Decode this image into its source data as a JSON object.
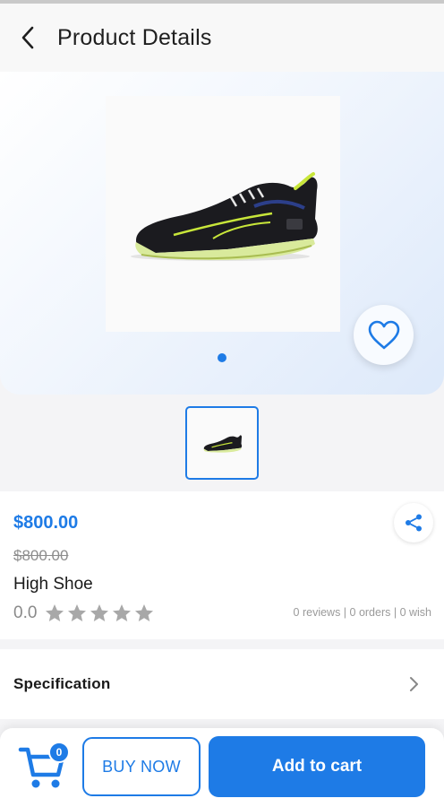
{
  "header": {
    "title": "Product Details",
    "back_icon": "chevron-left-icon"
  },
  "gallery": {
    "image": "running-shoe-image",
    "wishlist_icon": "heart-outline-icon",
    "page_indicator_count": 1,
    "active_page": 1,
    "thumbnails": [
      "running-shoe-thumbnail"
    ]
  },
  "product": {
    "price": "$800.00",
    "old_price": "$800.00",
    "name": "High Shoe",
    "rating": "0.0",
    "rating_stars_filled": 0,
    "rating_stars_total": 5,
    "stats": "0 reviews | 0 orders | 0 wish",
    "share_icon": "share-icon"
  },
  "specification": {
    "label": "Specification",
    "icon": "chevron-right-icon"
  },
  "bottom_bar": {
    "cart_icon": "shopping-cart-icon",
    "cart_count": "0",
    "buy_now_label": "BUY NOW",
    "add_to_cart_label": "Add to cart"
  },
  "colors": {
    "accent": "#1e7be6",
    "star_empty": "#a8a8a8",
    "shoe_body": "#1b1b1f",
    "shoe_accent": "#c8e63a"
  }
}
